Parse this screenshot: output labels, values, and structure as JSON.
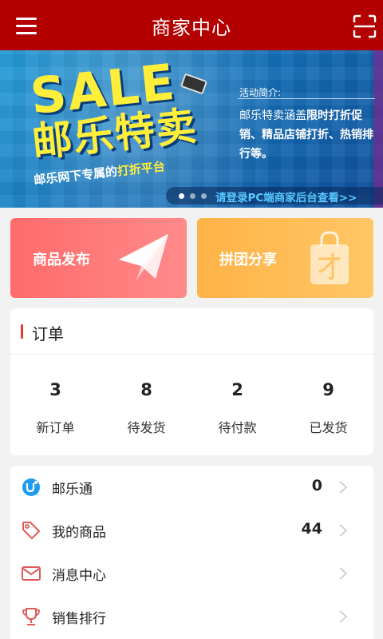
{
  "header": {
    "title": "商家中心",
    "menu_icon": "hamburger-menu-icon",
    "scan_icon": "scan-icon",
    "background": "#b30000"
  },
  "banner": {
    "headline_en": "SALE",
    "headline_cn": "邮乐特卖",
    "slogan_pre": "邮乐网下专属的",
    "slogan_highlight": "打折平台",
    "intro_label": "活动简介:",
    "intro_pre": "邮乐特卖涵盖",
    "intro_bold": "限时打折促销、精品店铺打折、热销排行等。",
    "footer_text": "请登录PC端商家后台查看>>",
    "slide_count": 3,
    "active_slide": 0
  },
  "feature_cards": [
    {
      "label": "商品发布",
      "icon": "paper-plane-icon",
      "color": "#ff6b6b"
    },
    {
      "label": "拼团分享",
      "icon": "shopping-bag-icon",
      "color": "#ffb347"
    }
  ],
  "orders": {
    "title": "订单",
    "stats": [
      {
        "count": "3",
        "label": "新订单"
      },
      {
        "count": "8",
        "label": "待发货"
      },
      {
        "count": "2",
        "label": "待付款"
      },
      {
        "count": "9",
        "label": "已发货"
      }
    ]
  },
  "menu": [
    {
      "label": "邮乐通",
      "count": "0",
      "icon": "uletong-icon"
    },
    {
      "label": "我的商品",
      "count": "44",
      "icon": "price-tag-icon"
    },
    {
      "label": "消息中心",
      "count": "",
      "icon": "envelope-icon"
    },
    {
      "label": "销售排行",
      "count": "",
      "icon": "trophy-icon"
    }
  ]
}
